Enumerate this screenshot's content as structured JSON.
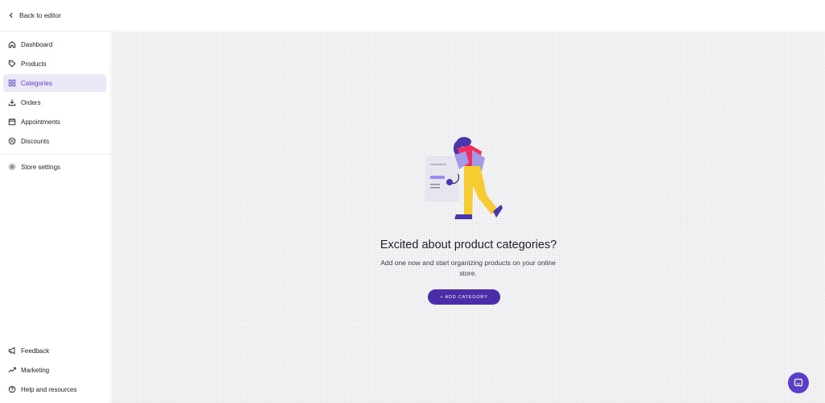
{
  "topbar": {
    "back_label": "Back to editor"
  },
  "sidebar": {
    "items": [
      {
        "label": "Dashboard",
        "icon": "home-icon"
      },
      {
        "label": "Products",
        "icon": "tag-icon"
      },
      {
        "label": "Categories",
        "icon": "grid-icon",
        "active": true
      },
      {
        "label": "Orders",
        "icon": "download-icon"
      },
      {
        "label": "Appointments",
        "icon": "calendar-icon"
      },
      {
        "label": "Discounts",
        "icon": "discount-icon"
      }
    ],
    "settings": {
      "label": "Store settings",
      "icon": "gear-icon"
    },
    "bottom": [
      {
        "label": "Feedback",
        "icon": "megaphone-icon"
      },
      {
        "label": "Marketing",
        "icon": "trend-icon"
      },
      {
        "label": "Help and resources",
        "icon": "help-icon"
      }
    ]
  },
  "empty_state": {
    "title": "Excited about product categories?",
    "description": "Add one now and start organizing products on your online store.",
    "button_label": "+ ADD CATEGORY"
  },
  "colors": {
    "accent": "#5a3ec8",
    "active_bg": "#ebe7f6",
    "button": "#4b2da8"
  }
}
